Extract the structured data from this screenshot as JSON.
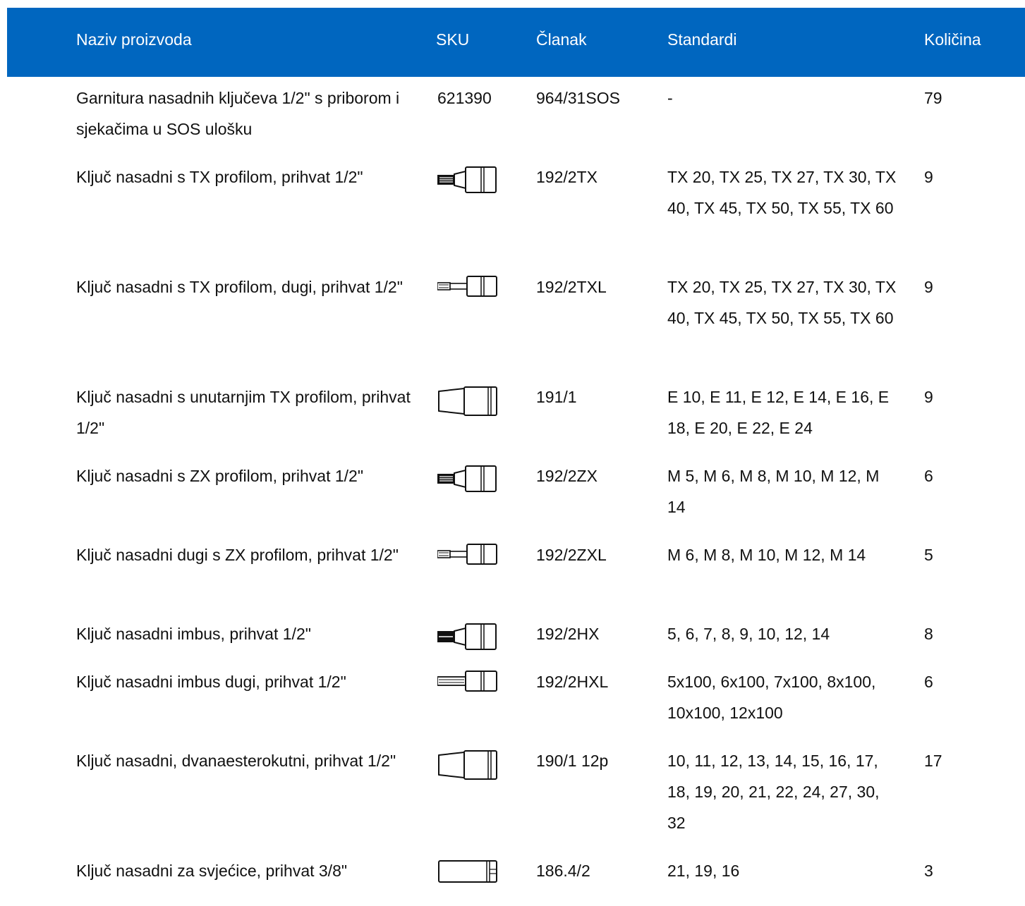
{
  "header": {
    "name": "Naziv proizvoda",
    "sku": "SKU",
    "article": "Članak",
    "standards": "Standardi",
    "quantity": "Količina"
  },
  "colors": {
    "header_bg": "#0066bf",
    "header_text": "#ffffff"
  },
  "rows": [
    {
      "name": "Garnitura nasadnih ključeva 1/2\" s priborom i sjekačima u SOS ulošku",
      "sku": "621390",
      "article": "964/31SOS",
      "standards": "-",
      "quantity": "79"
    },
    {
      "name": "Ključ nasadni s TX profilom, prihvat 1/2\"",
      "sku_icon": "tx-bit-socket-icon",
      "article": "192/2TX",
      "standards": "TX 20, TX 25, TX 27, TX 30, TX 40, TX 45, TX 50, TX 55, TX 60",
      "quantity": "9"
    },
    {
      "name": "Ključ nasadni s TX profilom, dugi, prihvat 1/2\"",
      "sku_icon": "tx-long-bit-socket-icon",
      "article": "192/2TXL",
      "standards": "TX 20, TX 25, TX 27, TX 30, TX 40, TX 45, TX 50, TX 55, TX 60",
      "quantity": "9"
    },
    {
      "name": "Ključ nasadni s unutarnjim TX profilom, prihvat 1/2\"",
      "sku_icon": "socket-icon",
      "article": "191/1",
      "standards": "E 10, E 11, E 12, E 14, E 16, E 18, E 20, E 22, E 24",
      "quantity": "9"
    },
    {
      "name": "Ključ nasadni s ZX profilom, prihvat 1/2\"",
      "sku_icon": "zx-bit-socket-icon",
      "article": "192/2ZX",
      "standards": "M 5, M 6, M 8, M 10, M 12, M 14",
      "quantity": "6"
    },
    {
      "name": "Ključ nasadni dugi s ZX profilom, prihvat 1/2\"",
      "sku_icon": "zx-long-bit-socket-icon",
      "article": "192/2ZXL",
      "standards": "M 6, M 8, M 10, M 12, M 14",
      "quantity": "5"
    },
    {
      "name": "Ključ nasadni imbus, prihvat 1/2\"",
      "sku_icon": "hex-bit-socket-icon",
      "article": "192/2HX",
      "standards": "5, 6, 7, 8, 9, 10, 12, 14",
      "quantity": "8"
    },
    {
      "name": "Ključ nasadni imbus dugi, prihvat 1/2\"",
      "sku_icon": "hex-long-bit-socket-icon",
      "article": "192/2HXL",
      "standards": "5x100, 6x100, 7x100, 8x100, 10x100, 12x100",
      "quantity": "6"
    },
    {
      "name": "Ključ nasadni, dvanaesterokutni, prihvat 1/2\"",
      "sku_icon": "twelve-point-socket-icon",
      "article": "190/1 12p",
      "standards": "10, 11, 12, 13, 14, 15, 16, 17, 18, 19, 20, 21, 22, 24, 27, 30, 32",
      "quantity": "17"
    },
    {
      "name": "Ključ nasadni za svjećice, prihvat 3/8\"",
      "sku_icon": "spark-plug-socket-icon",
      "article": "186.4/2",
      "standards": "21, 19, 16",
      "quantity": "3"
    }
  ]
}
